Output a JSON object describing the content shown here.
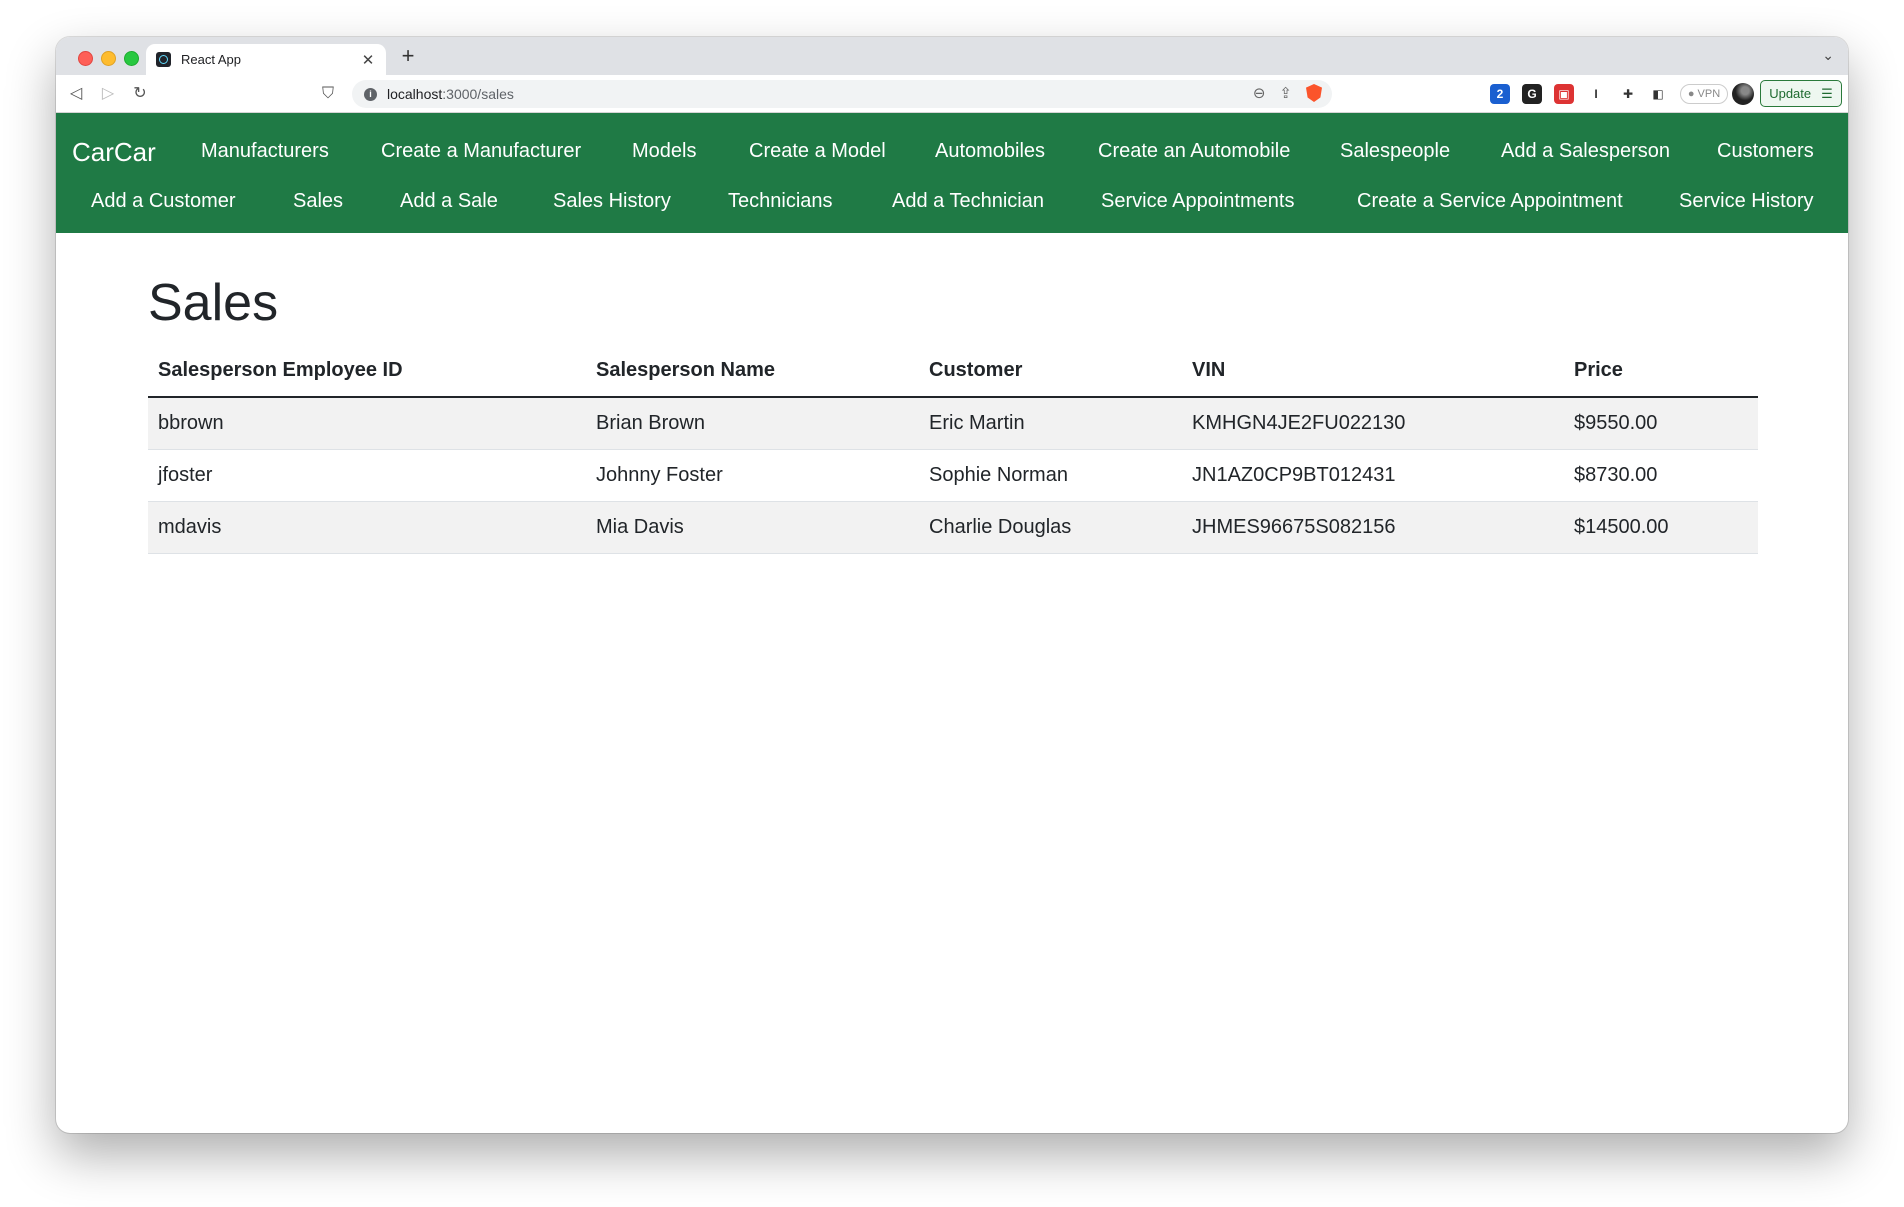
{
  "browser": {
    "tab_title": "React App",
    "tab_close": "✕",
    "new_tab": "+",
    "url_host": "localhost",
    "url_path": ":3000/sales",
    "vpn_label": "VPN",
    "update_label": "Update",
    "extension_badge": "2"
  },
  "navbar": {
    "brand": "CarCar",
    "links": [
      "Manufacturers",
      "Create a Manufacturer",
      "Models",
      "Create a Model",
      "Automobiles",
      "Create an Automobile",
      "Salespeople",
      "Add a Salesperson",
      "Customers",
      "Add a Customer",
      "Sales",
      "Add a Sale",
      "Sales History",
      "Technicians",
      "Add a Technician",
      "Service Appointments",
      "Create a Service Appointment",
      "Service History"
    ]
  },
  "main": {
    "title": "Sales",
    "table": {
      "columns": [
        "Salesperson Employee ID",
        "Salesperson Name",
        "Customer",
        "VIN",
        "Price"
      ],
      "rows": [
        [
          "bbrown",
          "Brian Brown",
          "Eric Martin",
          "KMHGN4JE2FU022130",
          "$9550.00"
        ],
        [
          "jfoster",
          "Johnny Foster",
          "Sophie Norman",
          "JN1AZ0CP9BT012431",
          "$8730.00"
        ],
        [
          "mdavis",
          "Mia Davis",
          "Charlie Douglas",
          "JHMES96675S082156",
          "$14500.00"
        ]
      ]
    }
  },
  "colors": {
    "navbar_bg": "#1f7a45",
    "row_stripe": "#f2f2f2"
  }
}
